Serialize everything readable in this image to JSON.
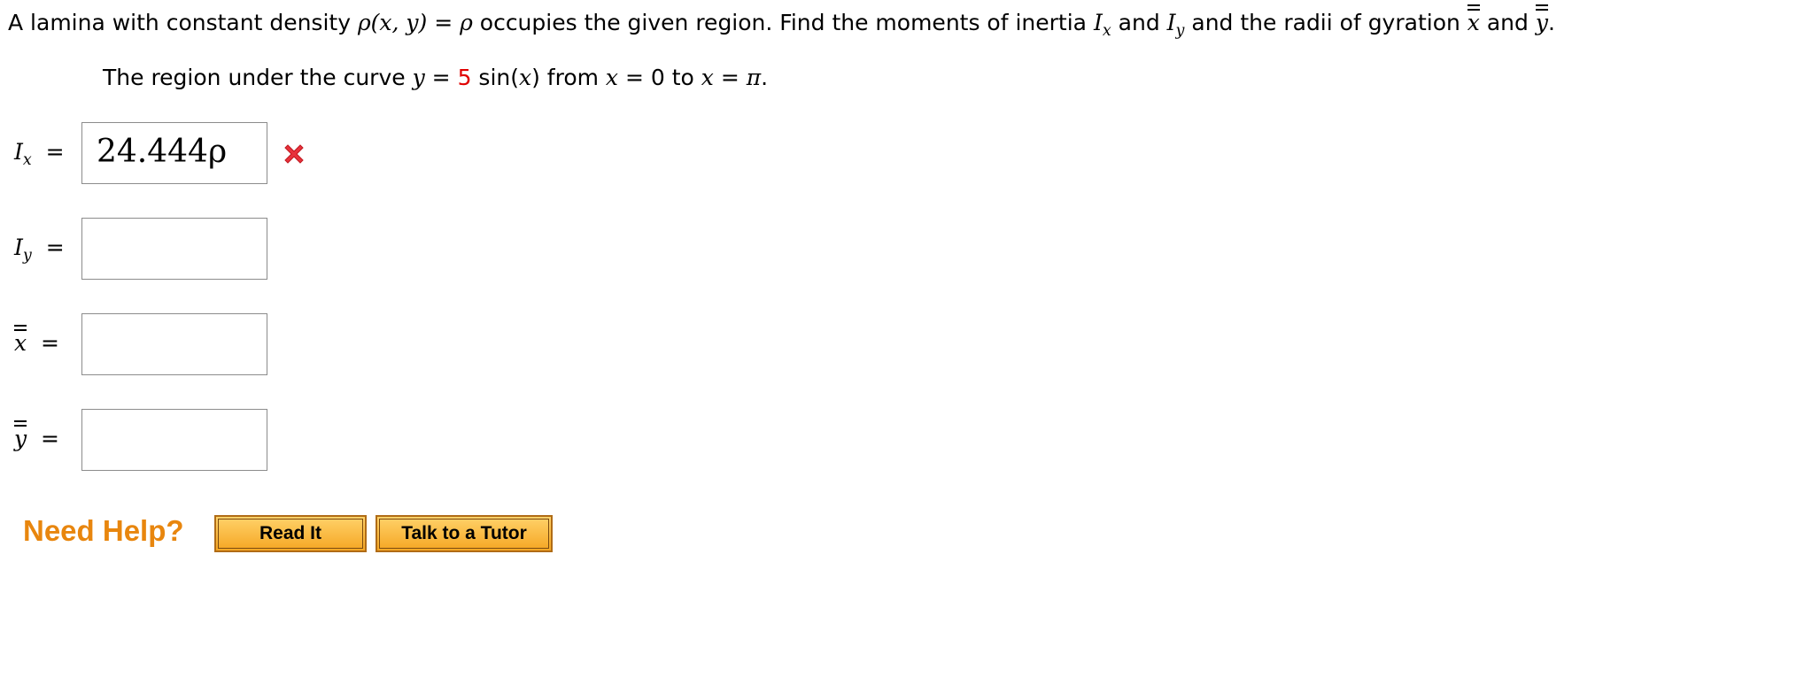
{
  "problem": {
    "text_1": "A lamina with constant density ",
    "rho_fn": "ρ(x, y)",
    "eq": " = ",
    "rho": "ρ",
    "text_2": " occupies the given region. Find the moments of inertia ",
    "ix_I": "I",
    "ix_sub": "x",
    "and_1": " and ",
    "iy_I": "I",
    "iy_sub": "y",
    "text_3": " and the radii of gyration ",
    "xbar": "x",
    "and_2": " and ",
    "ybar": "y",
    "period": "."
  },
  "region": {
    "text_1": "The region under the curve ",
    "y": "y",
    "eq_1": " = ",
    "coef": "5",
    "fn": " sin(",
    "x_1": "x",
    "text_2": ") from ",
    "x_2": "x",
    "eq_2": " = 0 to ",
    "x_3": "x",
    "eq_3": " = ",
    "pi": "π",
    "period": "."
  },
  "answers": [
    {
      "label_main": "I",
      "label_sub": "x",
      "equals": "=",
      "value": "24.444ρ",
      "status": "incorrect"
    },
    {
      "label_main": "I",
      "label_sub": "y",
      "equals": "=",
      "value": ""
    },
    {
      "label_main": "x",
      "label_sub": "",
      "equals": "=",
      "value": ""
    },
    {
      "label_main": "y",
      "label_sub": "",
      "equals": "=",
      "value": ""
    }
  ],
  "help": {
    "label": "Need Help?",
    "read_it": "Read It",
    "talk_to_tutor": "Talk to a Tutor"
  },
  "colors": {
    "need_help": "#e8860e",
    "incorrect_icon": "#e8323c",
    "highlight_number": "#e00000",
    "button_fill": "#f5a623"
  },
  "icons": {
    "incorrect": "x-mark-icon"
  }
}
